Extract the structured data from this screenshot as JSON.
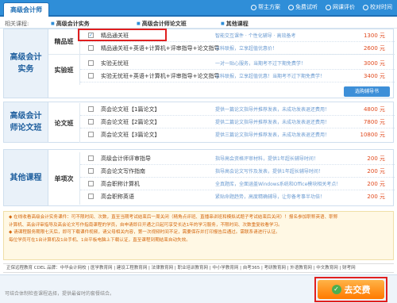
{
  "header": {
    "tab": "高级会计师",
    "links": [
      {
        "label": "帮主方案",
        "icon": "cart-icon"
      },
      {
        "label": "免费试听",
        "icon": "play-icon"
      },
      {
        "label": "网课评价",
        "icon": "comment-icon"
      },
      {
        "label": "校对时间",
        "icon": "clock-icon"
      }
    ]
  },
  "categories": {
    "label": "相关课程:",
    "items": [
      "高级会计实务",
      "高级会计师论文班",
      "其他课程"
    ]
  },
  "sections": [
    {
      "title": "高级会计\n实务",
      "groups": [
        {
          "name": "精品班",
          "rows": [
            {
              "name": "精品通关班",
              "desc": "智能交互课件 · 个性化辅导 · 高效备考",
              "price": "1300 元",
              "checked": true
            },
            {
              "name": "精品通关班+英语+计算机+评审指导+论文指导",
              "desc": "五科联报，立享超值优惠价！",
              "price": "2600 元",
              "checked": false
            }
          ]
        },
        {
          "name": "实验班",
          "rows": [
            {
              "name": "实验无忧班",
              "desc": "一对一贴心服务，当期考不过下期免费学！",
              "price": "3000 元",
              "checked": false
            },
            {
              "name": "实验无忧班+英语+计算机+评审指导+论文指导",
              "desc": "五科联报，立享超值优惠！当期考不过下期免费学！",
              "price": "3400 元",
              "checked": false
            }
          ]
        }
      ],
      "more_button": "选购辅导书"
    },
    {
      "title": "高级会计\n师论文班",
      "groups": [
        {
          "name": "论文班",
          "rows": [
            {
              "name": "高会论文班【1篇论文】",
              "desc": "提供一篇论文指导并推荐发表，未成功发表退还费用！",
              "price": "4800 元",
              "checked": false
            },
            {
              "name": "高会论文班【2篇论文】",
              "desc": "提供二篇论文指导并推荐发表，未成功发表退还费用！",
              "price": "7800 元",
              "checked": false
            },
            {
              "name": "高会论文班【3篇论文】",
              "desc": "提供三篇论文指导并推荐发表，未成功发表退还费用！",
              "price": "10800 元",
              "checked": false
            }
          ]
        }
      ]
    },
    {
      "title": "其他课程",
      "groups": [
        {
          "name": "单项次",
          "rows": [
            {
              "name": "高级会计师评审指导",
              "desc": "指导高会资格评审材料，提供1年超长辅导时间！",
              "price": "200 元",
              "checked": false
            },
            {
              "name": "高会论文写作指南",
              "desc": "指导高会论文写作及发表，提供1年超长辅导时间！",
              "price": "200 元",
              "checked": false
            },
            {
              "name": "高会职称计算机",
              "desc": "全真题库，全面涵盖Windows系统和Office模块相关考点！",
              "price": "200 元",
              "checked": false
            },
            {
              "name": "高会职称英语",
              "desc": "紧贴命题趋势，高度精确辅导，让你备考事半功倍！",
              "price": "200 元",
              "checked": false
            }
          ]
        }
      ]
    }
  ],
  "notice": [
    "◆ 在线收看高级会计实务课件：可不限时间、次数，直至当期考试结束后一周关闭（精角点评班、直播串讲班和模拟试题子考试结束后关闭）！报名参加职称英语、职称",
    "  计算机、高会评审指导及高会论文写作指南课程的学员，自申请即日开通之日起可享受长达1年的学习服务，不限时间、次数重复收看学习。",
    "◆ 请课程服务期限七天后，即可下载课件视频，请父母相关内容，第一次视频时间不足，需要保存并打印报告后通过。需联系请进行认证。",
    "  每位学员可在1台计算机及1台手机、1台平板电脑上下载认证，直至课程到期结束自动失效。"
  ],
  "partners": "正保远程教育 CDEL 品牌：中华会计网校 | 医学教育网 | 建设工程教育网 | 法律教育网 | 职业培训教育网 | 中小学教育网 | 自考365 | 考研教育网 | 外语教育网 | 中文教育网 | 财考网",
  "bottom": {
    "hint": "可结合体制检查课程选择，提供最省时的套餐结合。",
    "pay_button": "去交费"
  }
}
